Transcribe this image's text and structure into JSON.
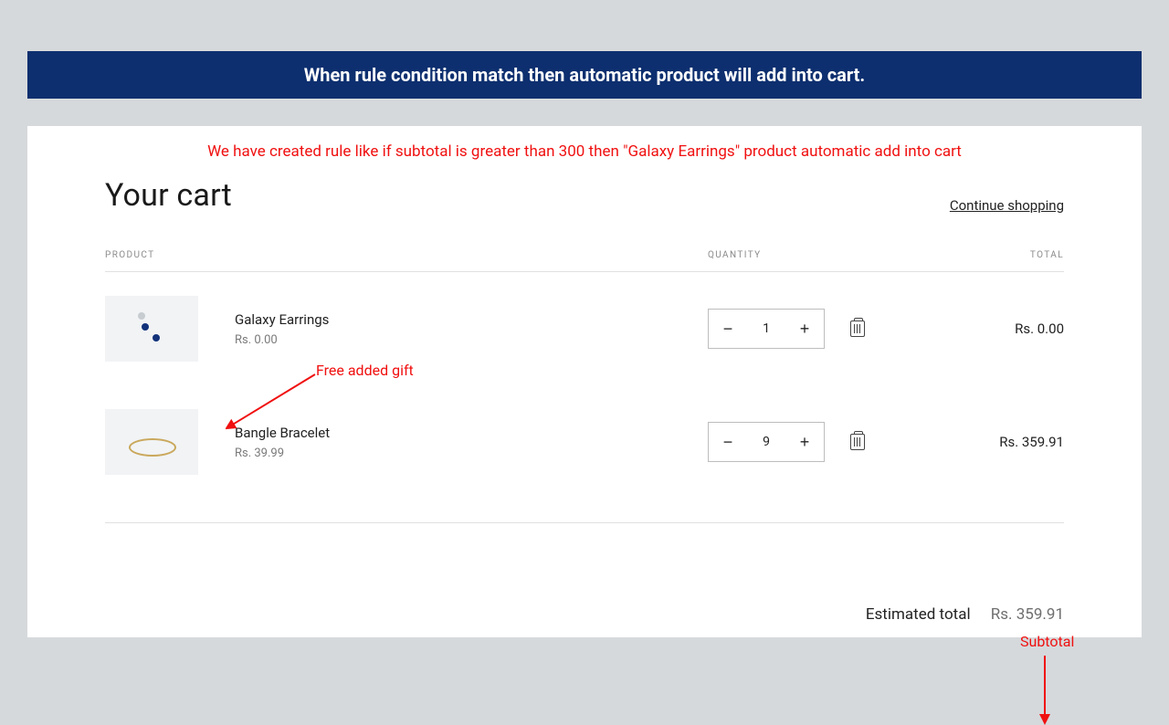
{
  "banner": "When rule condition match then automatic product will add into cart.",
  "rule_note": "We have created rule like if subtotal is greater than 300 then \"Galaxy Earrings\" product automatic add into cart",
  "cart": {
    "title": "Your cart",
    "continue_label": "Continue shopping",
    "columns": {
      "product": "Product",
      "quantity": "Quantity",
      "total": "Total"
    },
    "items": [
      {
        "name": "Galaxy Earrings",
        "price": "Rs. 0.00",
        "qty": "1",
        "line_total": "Rs. 0.00"
      },
      {
        "name": "Bangle Bracelet",
        "price": "Rs. 39.99",
        "qty": "9",
        "line_total": "Rs. 359.91"
      }
    ],
    "estimated_label": "Estimated total",
    "estimated_value": "Rs. 359.91"
  },
  "annotations": {
    "free_gift": "Free added gift",
    "subtotal": "Subtotal"
  },
  "glyphs": {
    "minus": "−",
    "plus": "+"
  }
}
